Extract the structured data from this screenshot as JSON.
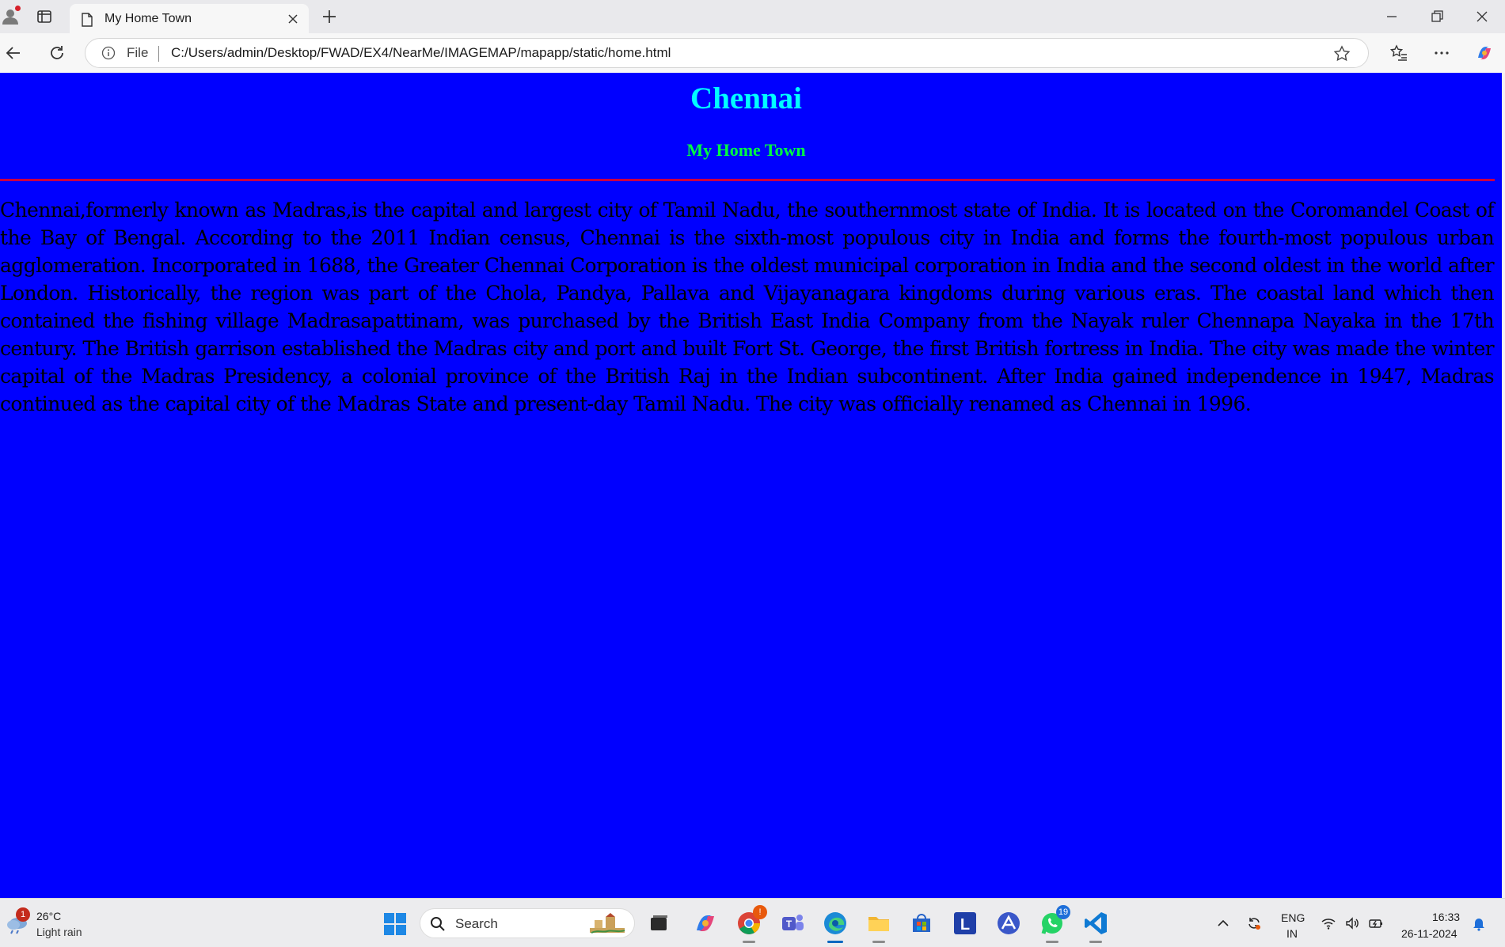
{
  "browser": {
    "tab": {
      "title": "My Home Town"
    },
    "address": {
      "scheme": "File",
      "url": "C:/Users/admin/Desktop/FWAD/EX4/NearMe/IMAGEMAP/mapapp/static/home.html"
    }
  },
  "page": {
    "background_color": "#0000ff",
    "heading": "Chennai",
    "heading_color": "#00ffff",
    "subheading": "My Home Town",
    "subheading_color": "#00ff40",
    "rule_color": "#cc0044",
    "paragraph": "Chennai,formerly known as Madras,is the capital and largest city of Tamil Nadu, the southernmost state of India. It is located on the Coromandel Coast of the Bay of Bengal. According to the 2011 Indian census, Chennai is the sixth-most populous city in India and forms the fourth-most populous urban agglomeration. Incorporated in 1688, the Greater Chennai Corporation is the oldest municipal corporation in India and the second oldest in the world after London. Historically, the region was part of the Chola, Pandya, Pallava and Vijayanagara kingdoms during various eras. The coastal land which then contained the fishing village Madrasapattinam, was purchased by the British East India Company from the Nayak ruler Chennapa Nayaka in the 17th century. The British garrison established the Madras city and port and built Fort St. George, the first British fortress in India. The city was made the winter capital of the Madras Presidency, a colonial province of the British Raj in the Indian subcontinent. After India gained independence in 1947, Madras continued as the capital city of the Madras State and present-day Tamil Nadu. The city was officially renamed as Chennai in 1996."
  },
  "taskbar": {
    "weather": {
      "badge": "1",
      "temperature": "26°C",
      "condition": "Light rain"
    },
    "search_placeholder": "Search",
    "apps": [
      {
        "name": "task-view",
        "icon": "task-view-icon"
      },
      {
        "name": "copilot",
        "icon": "copilot-icon"
      },
      {
        "name": "chrome",
        "icon": "chrome-icon",
        "badge": "!"
      },
      {
        "name": "teams",
        "icon": "teams-icon"
      },
      {
        "name": "edge",
        "icon": "edge-icon"
      },
      {
        "name": "file-explorer",
        "icon": "folder-icon"
      },
      {
        "name": "store",
        "icon": "store-icon"
      },
      {
        "name": "l-app",
        "icon": "l-app-icon",
        "label": "L"
      },
      {
        "name": "arc-app",
        "icon": "arc-app-icon"
      },
      {
        "name": "whatsapp",
        "icon": "whatsapp-icon",
        "badge": "19"
      },
      {
        "name": "vscode",
        "icon": "vscode-icon"
      }
    ],
    "language_primary": "ENG",
    "language_region": "IN",
    "time": "16:33",
    "date": "26-11-2024"
  }
}
